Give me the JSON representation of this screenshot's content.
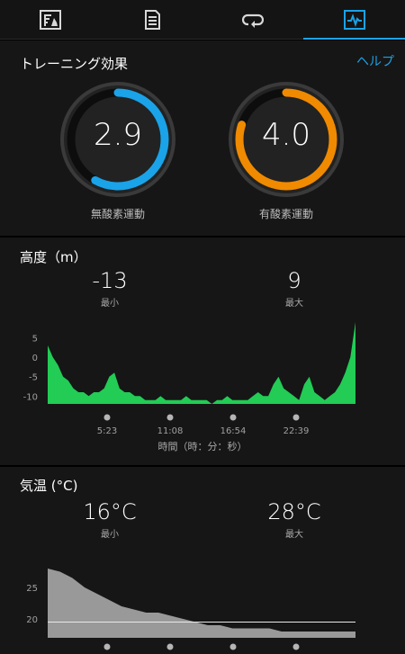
{
  "tabs": [
    {
      "name": "tab-summary",
      "icon": "flag-chart-icon",
      "active": false
    },
    {
      "name": "tab-details",
      "icon": "document-icon",
      "active": false
    },
    {
      "name": "tab-laps",
      "icon": "laps-icon",
      "active": false
    },
    {
      "name": "tab-charts",
      "icon": "chart-icon",
      "active": true
    }
  ],
  "training_effect": {
    "title": "トレーニング効果",
    "help_label": "ヘルプ",
    "aerobic": {
      "value": "2.9",
      "label": "無酸素運動",
      "fraction": 0.58,
      "color": "#1aa3e8"
    },
    "anaerobic": {
      "value": "4.0",
      "label": "有酸素運動",
      "fraction": 0.8,
      "color": "#f08a00"
    }
  },
  "elevation": {
    "title": "高度（m）",
    "min_value": "-13",
    "min_label": "最小",
    "max_value": "9",
    "max_label": "最大",
    "axis_title": "時間（時：分：秒）",
    "y_ticks": [
      "5",
      "0",
      "-5",
      "-10"
    ],
    "x_ticks": [
      "5:23",
      "11:08",
      "16:54",
      "22:39"
    ]
  },
  "temperature": {
    "title": "気温 (°C)",
    "min_value": "16°C",
    "min_label": "最小",
    "max_value": "28°C",
    "max_label": "最大",
    "y_ticks": [
      "25",
      "20"
    ]
  },
  "chart_data": [
    {
      "type": "area",
      "ylim": [
        -12,
        9
      ],
      "x": [
        0,
        1,
        2,
        3,
        4,
        5,
        6,
        7,
        8,
        9,
        10,
        11,
        12,
        13,
        14,
        15,
        16,
        17,
        18,
        19,
        20,
        21,
        22,
        23,
        24,
        25,
        26,
        27,
        28,
        29,
        30,
        31,
        32,
        33,
        34,
        35,
        36,
        37,
        38,
        39,
        40,
        41,
        42,
        43,
        44,
        45,
        46,
        47,
        48,
        49,
        50,
        51,
        52,
        53,
        54,
        55,
        56,
        57,
        58,
        59,
        60
      ],
      "values": [
        3,
        0,
        -2,
        -5,
        -6,
        -8,
        -9,
        -9,
        -10,
        -9,
        -9,
        -8,
        -5,
        -4,
        -8,
        -9,
        -9,
        -10,
        -10,
        -11,
        -11,
        -11,
        -10,
        -11,
        -11,
        -11,
        -11,
        -10,
        -11,
        -11,
        -11,
        -11,
        -12,
        -11,
        -11,
        -10,
        -11,
        -11,
        -11,
        -11,
        -10,
        -9,
        -10,
        -10,
        -7,
        -5,
        -8,
        -9,
        -10,
        -11,
        -7,
        -5,
        -9,
        -10,
        -11,
        -10,
        -9,
        -7,
        -4,
        0,
        9
      ],
      "color": "#22cc55"
    },
    {
      "type": "area",
      "ylim": [
        17,
        29
      ],
      "x": [
        0,
        1,
        2,
        3,
        4,
        5,
        6,
        7,
        8,
        9,
        10,
        11,
        12,
        13,
        14,
        15,
        16,
        17,
        18,
        19,
        20,
        21,
        22,
        23,
        24,
        25
      ],
      "values": [
        28,
        27.5,
        26.5,
        25,
        24,
        23,
        22,
        21.5,
        21,
        21,
        20.5,
        20,
        19.5,
        19,
        19,
        18.5,
        18.5,
        18.5,
        18.5,
        18,
        18,
        18,
        18,
        18,
        18,
        18
      ],
      "reference_line": 19.5,
      "color": "#999999"
    }
  ]
}
